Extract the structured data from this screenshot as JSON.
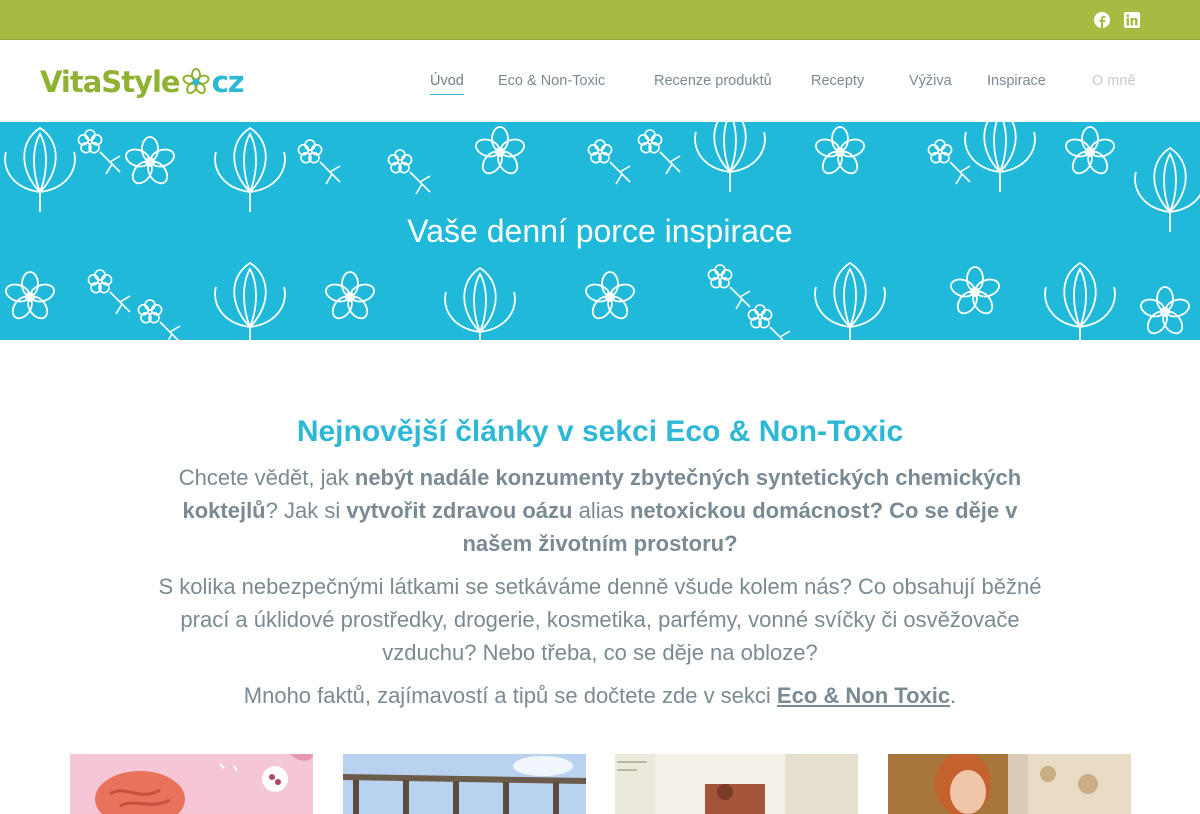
{
  "topbar": {
    "background": "#a9ba42",
    "icons": [
      "facebook-icon",
      "linkedin-icon"
    ]
  },
  "header": {
    "logo": {
      "part1": "VitaStyle",
      "part2": "cz"
    },
    "nav": [
      {
        "label": "Úvod"
      },
      {
        "label": "Eco & Non-Toxic"
      },
      {
        "label": "Recenze produktů"
      },
      {
        "label": "Recepty"
      },
      {
        "label": "Výživa"
      },
      {
        "label": "Inspirace"
      },
      {
        "label": "O mně"
      }
    ]
  },
  "hero": {
    "title": "Vaše denní porce inspirace",
    "background": "#20b9d9"
  },
  "main": {
    "heading": "Nejnovější články v sekci Eco & Non-Toxic",
    "intro": {
      "t1": "Chcete vědět, jak ",
      "b1": "nebýt nadále konzumenty zbytečných syntetických chemických koktejlů",
      "t2": "? Jak si ",
      "b2": "vytvořit zdravou oázu",
      "t3": " alias ",
      "b3": "netoxickou domácnost? Co se děje v našem životním prostoru?"
    },
    "paragraph2": "S kolika nebezpečnými látkami se setkáváme denně všude kolem nás? Co obsahují běžné prací a úklidové prostředky, drogerie, kosmetika, parfémy, vonné svíčky či osvěžovače vzduchu? Nebo třeba, co se děje na obloze?",
    "paragraph3": {
      "text": "Mnoho faktů, zajímavostí a tipů se dočtete zde v sekci ",
      "link": "Eco & Non Toxic",
      "end": "."
    },
    "accent": "#2fb8d6"
  }
}
